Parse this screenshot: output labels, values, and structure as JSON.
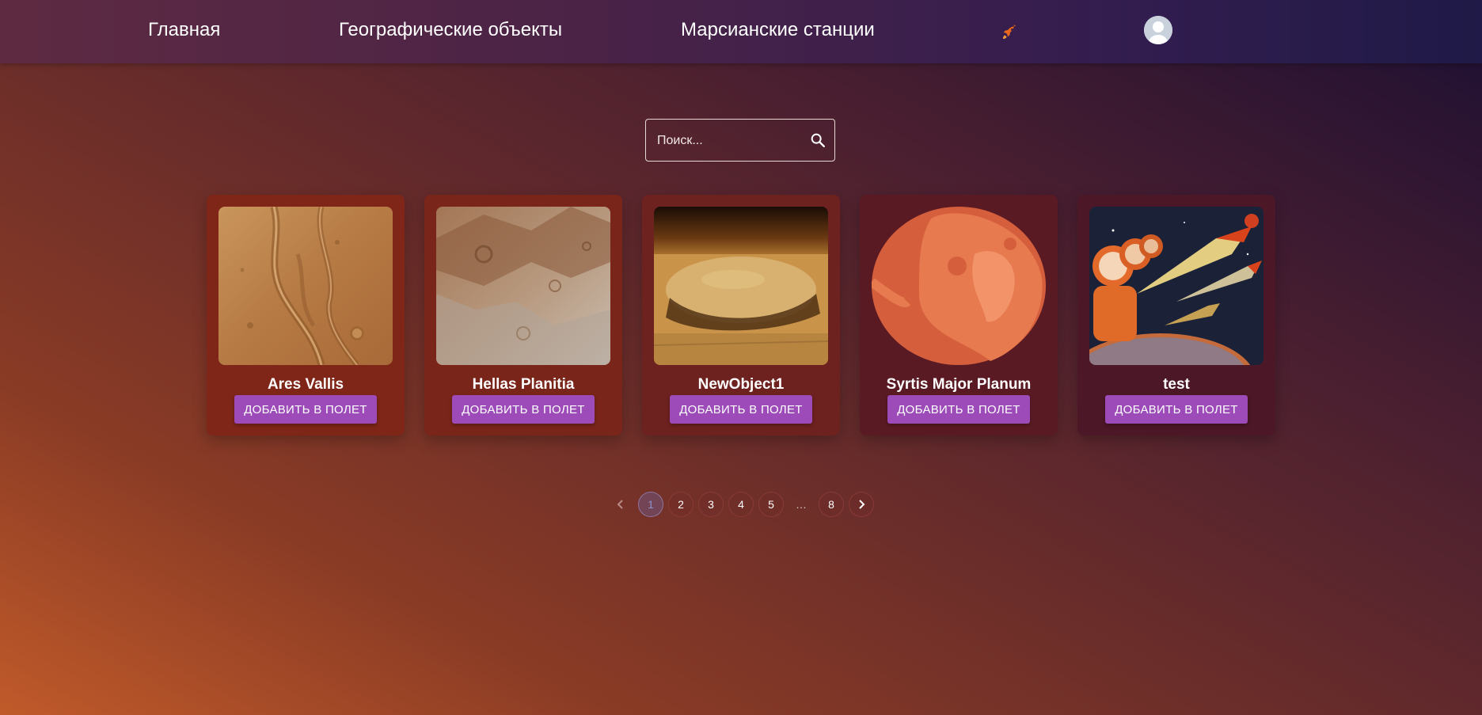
{
  "nav": {
    "home": "Главная",
    "geo_objects": "Географические объекты",
    "stations": "Марсианские станции",
    "rocket_icon": "rocket-icon",
    "avatar_icon": "user-avatar-icon"
  },
  "search": {
    "placeholder": "Поиск...",
    "value": "",
    "icon": "search-icon"
  },
  "cards": [
    {
      "title": "Ares Vallis",
      "button": "ДОБАВИТЬ В ПОЛЕТ",
      "bg": "#7f2618"
    },
    {
      "title": "Hellas Planitia",
      "button": "ДОБАВИТЬ В ПОЛЕТ",
      "bg": "#7a2519"
    },
    {
      "title": "NewObject1",
      "button": "ДОБАВИТЬ В ПОЛЕТ",
      "bg": "#6e221f"
    },
    {
      "title": "Syrtis Major Planum",
      "button": "ДОБАВИТЬ В ПОЛЕТ",
      "bg": "#5a1a23"
    },
    {
      "title": "test",
      "button": "ДОБАВИТЬ В ПОЛЕТ",
      "bg": "#4c1727"
    }
  ],
  "pagination": {
    "prev_icon": "chevron-left-icon",
    "pages": [
      "1",
      "2",
      "3",
      "4",
      "5"
    ],
    "ellipsis": "…",
    "last": "8",
    "current": "1",
    "next_icon": "chevron-right-icon"
  },
  "colors": {
    "button": "#9c4bb8",
    "accent_rocket": "#e8671c"
  }
}
